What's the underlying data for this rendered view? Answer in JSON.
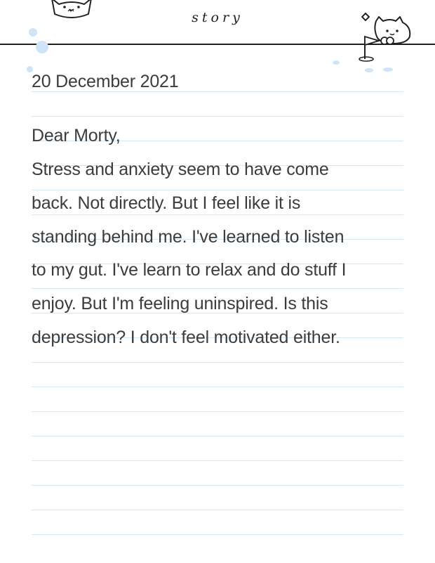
{
  "header": {
    "title": "story"
  },
  "entry": {
    "date": "20 December 2021",
    "greeting": "Dear Morty,",
    "body_lines": [
      "Stress and anxiety seem to have come",
      "back. Not directly. But I feel like it is",
      "standing behind me. I've learned to listen",
      "to my gut. I've learn to relax and do stuff I",
      "enjoy. But I'm feeling uninspired. Is this",
      "depression? I don't feel motivated either."
    ]
  },
  "colors": {
    "ruled_line": "#d6e7f5",
    "header_rule": "#1f1f1f",
    "text": "#3c3c3c",
    "accent_dots": "#cfe4f6"
  },
  "icons": [
    "cat-icon-left",
    "cat-golf-icon-right",
    "diamond-sparkle-icon"
  ]
}
